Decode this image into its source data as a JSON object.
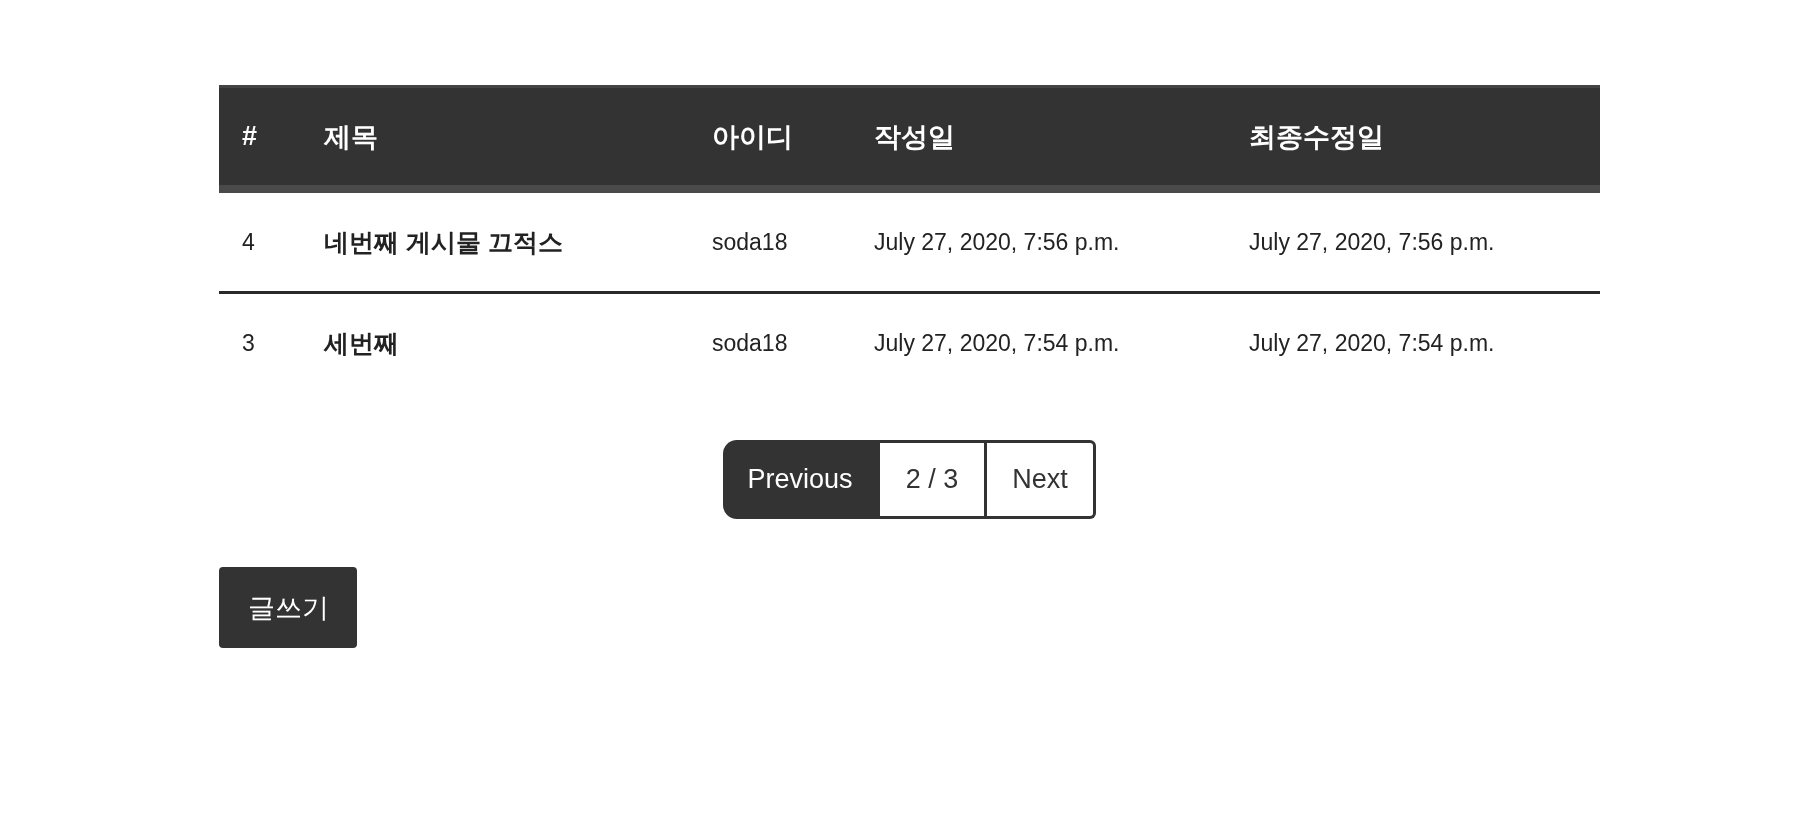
{
  "table": {
    "columns": [
      "#",
      "제목",
      "아이디",
      "작성일",
      "최종수정일"
    ],
    "rows": [
      {
        "number": "4",
        "title": "네번째 게시물 끄적스",
        "author": "soda18",
        "created": "July 27, 2020, 7:56 p.m.",
        "modified": "July 27, 2020, 7:56 p.m."
      },
      {
        "number": "3",
        "title": "세번째",
        "author": "soda18",
        "created": "July 27, 2020, 7:54 p.m.",
        "modified": "July 27, 2020, 7:54 p.m."
      }
    ]
  },
  "pagination": {
    "previous": "Previous",
    "current": "2 / 3",
    "next": "Next"
  },
  "write_button": "글쓰기"
}
